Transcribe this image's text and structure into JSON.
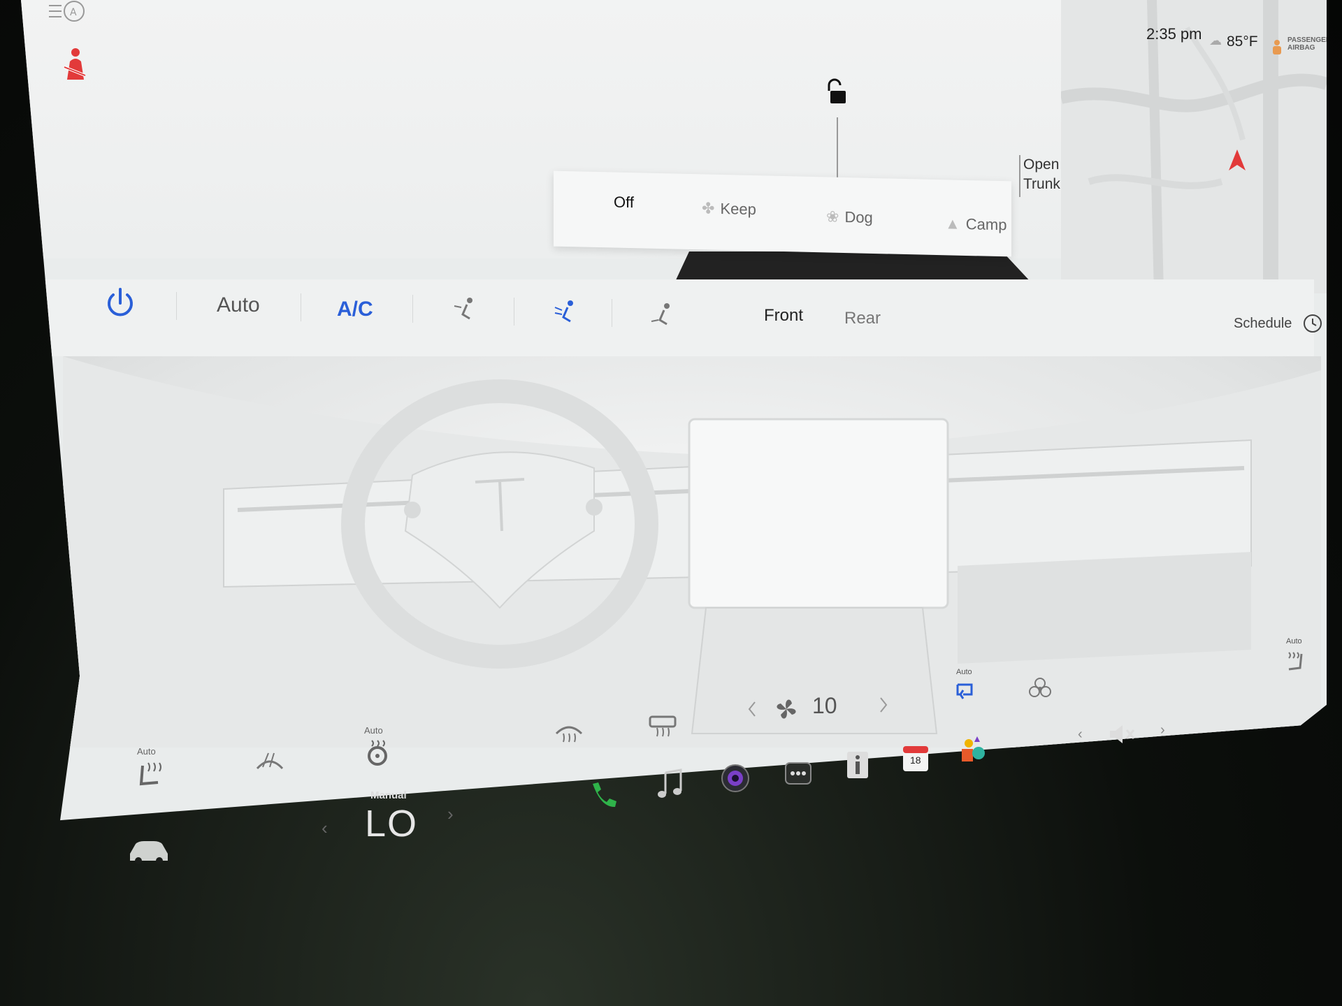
{
  "status": {
    "time": "2:35 pm",
    "temperature": "85°F",
    "airbag_line1": "PASSENGER",
    "airbag_line2": "AIRBAG"
  },
  "car_view": {
    "trunk_label_line1": "Open",
    "trunk_label_line2": "Trunk"
  },
  "climate_modes": {
    "off": "Off",
    "keep": "Keep",
    "dog": "Dog",
    "camp": "Camp"
  },
  "climate_bar": {
    "auto": "Auto",
    "ac": "A/C",
    "front": "Front",
    "rear": "Rear",
    "schedule": "Schedule"
  },
  "controls": {
    "fan_speed": "10",
    "recirc_label": "Auto",
    "seat_right_label": "Auto",
    "seat_left_label": "Auto",
    "steering_heat_label": "Auto"
  },
  "driver_temp": {
    "mode": "Manual",
    "value": "LO",
    "left_arrow": "‹",
    "right_arrow": "›"
  },
  "calendar": {
    "day": "18"
  },
  "colors": {
    "accent": "#2a5fd8",
    "warning": "#e23a3a",
    "phone": "#2fb34a"
  }
}
